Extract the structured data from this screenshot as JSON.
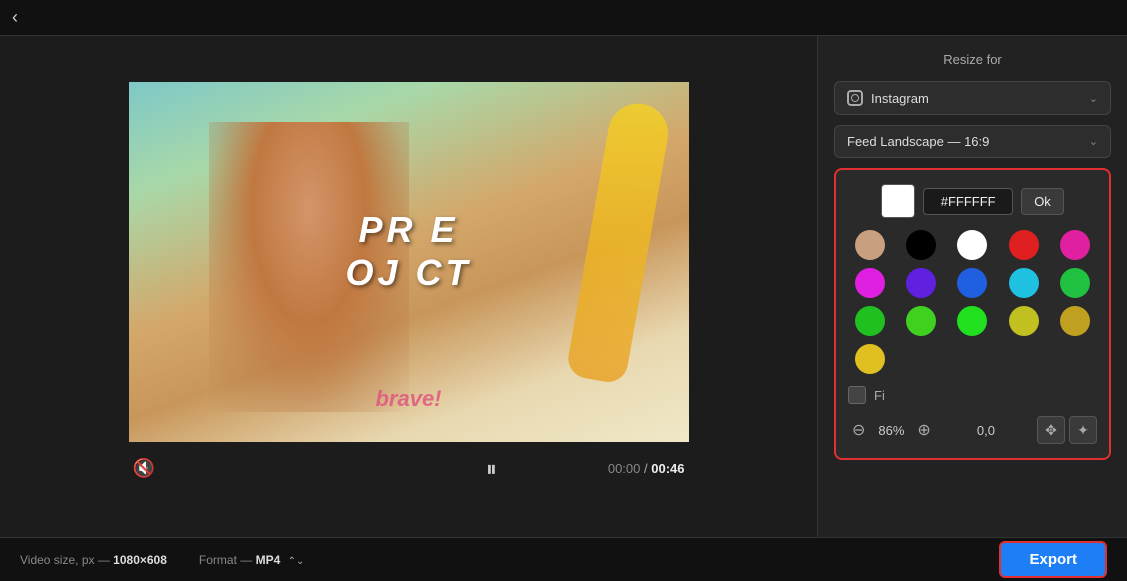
{
  "topbar": {
    "back_label": "‹"
  },
  "video": {
    "project_text_line1": "PR   E",
    "project_text_line2": "OJ CT",
    "brave_text": "brave!",
    "time_current": "00:00",
    "time_separator": "/",
    "time_total": "00:46"
  },
  "right_panel": {
    "resize_for_label": "Resize for",
    "platform_dropdown": {
      "label": "Instagram",
      "chevron": "⌄"
    },
    "format_dropdown": {
      "label": "Feed Landscape — 16:9",
      "chevron": "⌄"
    },
    "color_picker": {
      "hex_value": "#FFFFFF",
      "ok_label": "Ok",
      "colors": [
        {
          "color": "#c8a080",
          "name": "skin-tone"
        },
        {
          "color": "#000000",
          "name": "black"
        },
        {
          "color": "#ffffff",
          "name": "white"
        },
        {
          "color": "#e02020",
          "name": "red"
        },
        {
          "color": "#e020a0",
          "name": "hot-pink"
        },
        {
          "color": "#e020e0",
          "name": "magenta"
        },
        {
          "color": "#6020e0",
          "name": "purple"
        },
        {
          "color": "#2060e0",
          "name": "blue"
        },
        {
          "color": "#20c0e0",
          "name": "cyan"
        },
        {
          "color": "#20c040",
          "name": "green"
        },
        {
          "color": "#20c020",
          "name": "bright-green"
        },
        {
          "color": "#40d020",
          "name": "lime"
        },
        {
          "color": "#20e020",
          "name": "vivid-green"
        },
        {
          "color": "#c0c020",
          "name": "olive"
        },
        {
          "color": "#c0a020",
          "name": "gold"
        },
        {
          "color": "#e0c020",
          "name": "yellow"
        }
      ],
      "fill_label": "Fi",
      "zoom_percent": "86%",
      "coordinates": "0,0"
    }
  },
  "bottom_bar": {
    "video_size_label": "Video size, px —",
    "video_size_value": "1080×608",
    "format_label": "Format —",
    "format_value": "MP4",
    "format_chevron": "⌃⌄",
    "export_label": "Export"
  }
}
